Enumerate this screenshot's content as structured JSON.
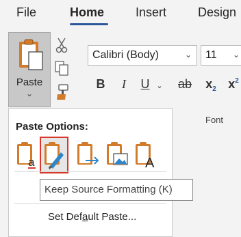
{
  "ribbon": {
    "tabs": [
      {
        "label": "File"
      },
      {
        "label": "Home"
      },
      {
        "label": "Insert"
      },
      {
        "label": "Design"
      }
    ],
    "active_tab": "Home"
  },
  "clipboard": {
    "paste_label": "Paste",
    "paste_caret": "⌄"
  },
  "font": {
    "name": "Calibri (Body)",
    "size": "11",
    "group_label": "Font",
    "buttons": [
      "B",
      "I",
      "U",
      "ab",
      "x2",
      "x2"
    ]
  },
  "paste_options": {
    "title": "Paste Options:",
    "options": [
      {
        "icon": "paste-use-destination-theme-icon",
        "accent": "a"
      },
      {
        "icon": "paste-keep-source-formatting-icon"
      },
      {
        "icon": "paste-merge-formatting-icon"
      },
      {
        "icon": "paste-picture-icon"
      },
      {
        "icon": "paste-keep-text-only-icon",
        "accent": "A"
      }
    ],
    "selected_index": 1,
    "tooltip": "Keep Source Formatting (K)",
    "set_default_prefix": "Set Def",
    "set_default_underlined": "a",
    "set_default_suffix": "ult Paste..."
  },
  "colors": {
    "accent": "#2b579a",
    "highlight": "#d9372b",
    "clipboard_orange": "#d27b2a",
    "blue_arrow": "#2e86c9"
  }
}
